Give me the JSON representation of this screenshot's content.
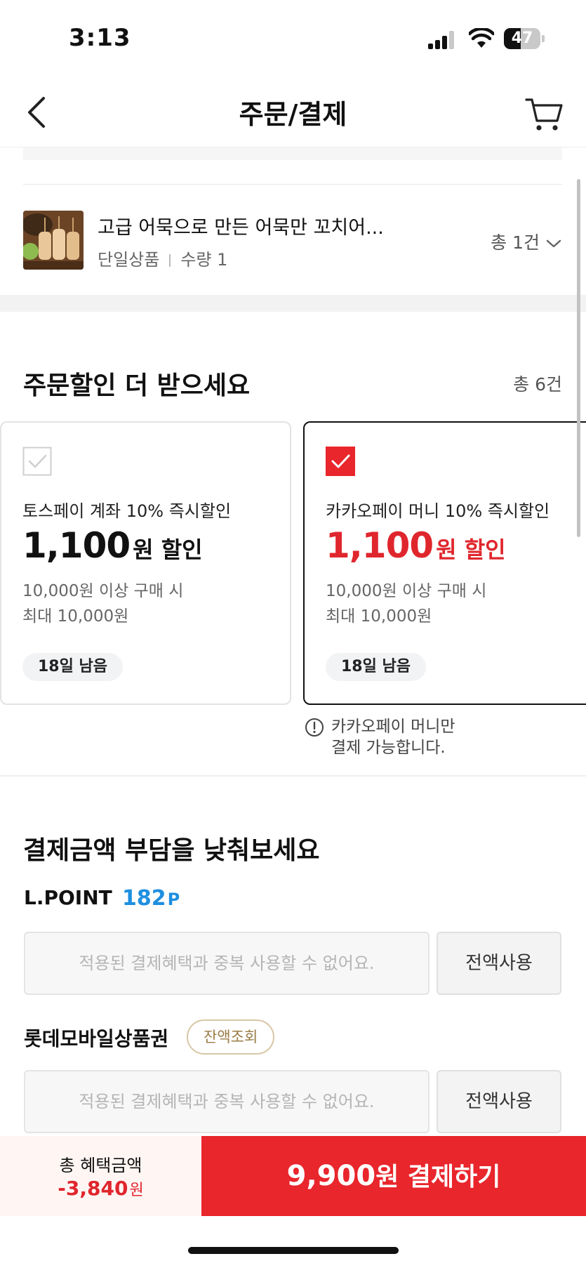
{
  "status_bar": {
    "time": "3:13",
    "battery": "47",
    "battery_level": 0.47,
    "icons": [
      "signal-icon",
      "wifi-icon",
      "battery-icon"
    ]
  },
  "header": {
    "title": "주문/결제",
    "back_icon": "chevron-left-icon",
    "cart_icon": "cart-icon"
  },
  "product": {
    "name": "고급 어묵으로 만든 어묵만 꼬치어...",
    "type": "단일상품",
    "quantity": "수량 1",
    "total": "총 1건"
  },
  "discounts": {
    "title": "주문할인 더 받으세요",
    "count": "총 6건",
    "cards": [
      {
        "checked": false,
        "title": "토스페이 계좌 10% 즉시할인",
        "amount": "1,100",
        "suffix": "원 할인",
        "cond1": "10,000원 이상 구매 시",
        "cond2": "최대 10,000원",
        "days": "18일 남음"
      },
      {
        "checked": true,
        "title": "카카오페이 머니 10% 즉시할인",
        "amount": "1,100",
        "suffix": "원 할인",
        "cond1": "10,000원 이상 구매 시",
        "cond2": "최대 10,000원",
        "days": "18일 남음"
      }
    ],
    "note_line1": "카카오페이 머니만",
    "note_line2": "결제 가능합니다."
  },
  "payment": {
    "title": "결제금액 부담을 낮춰보세요",
    "lpoint_label": "L.POINT",
    "lpoint_value": "182",
    "lpoint_unit": "P",
    "input_placeholder": "적용된 결제혜택과 중복 사용할 수 없어요.",
    "use_all_label": "전액사용",
    "giftcard_label": "롯데모바일상품권",
    "balance_label": "잔액조회"
  },
  "bottom_bar": {
    "benefit_label": "총 혜택금액",
    "benefit_value": "-3,840",
    "benefit_unit": "원",
    "pay_amount": "9,900",
    "pay_suffix": "원 결제하기"
  },
  "colors": {
    "accent_red": "#e8262c",
    "lpoint_blue": "#1e8fe0",
    "balance_gold": "#9a7b45"
  }
}
